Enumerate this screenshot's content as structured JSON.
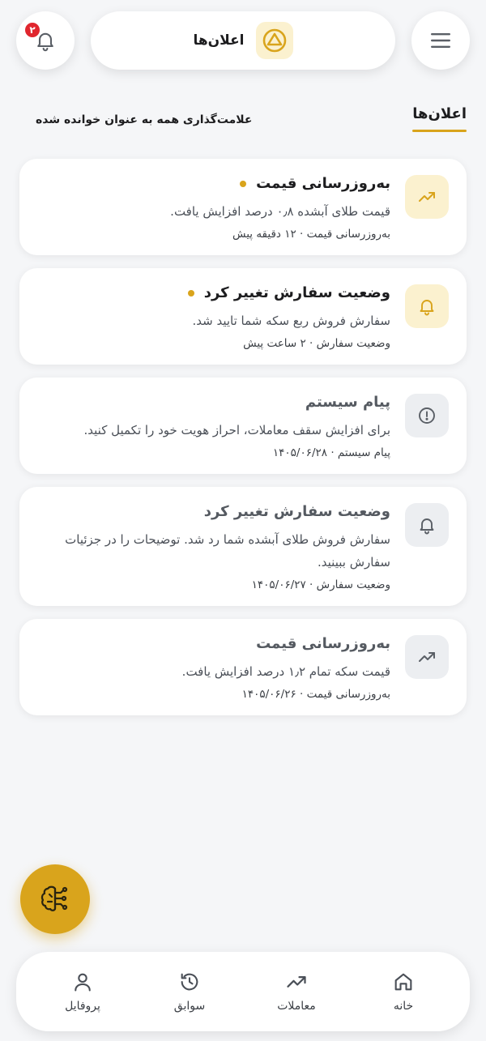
{
  "header": {
    "title": "اعلان‌ها",
    "notification_count": "۲"
  },
  "section": {
    "tab_label": "اعلان‌ها",
    "mark_all_read": "علامت‌گذاری همه به عنوان خوانده شده"
  },
  "notifications": [
    {
      "title": "به‌روزرسانی قیمت",
      "message": "قیمت طلای آبشده ۰٫۸ درصد افزایش یافت.",
      "meta": "به‌روزرسانی قیمت · ۱۲ دقیقه پیش",
      "icon": "trending-up-icon",
      "unread": true
    },
    {
      "title": "وضعیت سفارش تغییر کرد",
      "message": "سفارش فروش ربع سکه شما تایید شد.",
      "meta": "وضعیت سفارش · ۲ ساعت پیش",
      "icon": "bell-icon",
      "unread": true
    },
    {
      "title": "پیام سیستم",
      "message": "برای افزایش سقف معاملات، احراز هویت خود را تکمیل کنید.",
      "meta": "پیام سیستم · ۱۴۰۵/۰۶/۲۸",
      "icon": "alert-circle-icon",
      "unread": false
    },
    {
      "title": "وضعیت سفارش تغییر کرد",
      "message": "سفارش فروش طلای آبشده شما رد شد. توضیحات را در جزئیات سفارش ببینید.",
      "meta": "وضعیت سفارش · ۱۴۰۵/۰۶/۲۷",
      "icon": "bell-icon",
      "unread": false
    },
    {
      "title": "به‌روزرسانی قیمت",
      "message": "قیمت سکه تمام ۱٫۲ درصد افزایش یافت.",
      "meta": "به‌روزرسانی قیمت · ۱۴۰۵/۰۶/۲۶",
      "icon": "trending-up-icon",
      "unread": false
    }
  ],
  "bottom_nav": {
    "items": [
      {
        "label": "خانه",
        "icon": "home-icon"
      },
      {
        "label": "معاملات",
        "icon": "trending-up-icon"
      },
      {
        "label": "سوابق",
        "icon": "history-icon"
      },
      {
        "label": "پروفایل",
        "icon": "user-icon"
      }
    ]
  },
  "colors": {
    "accent": "#d9a41c",
    "badge": "#e0262e",
    "background": "#f5f6f8"
  }
}
